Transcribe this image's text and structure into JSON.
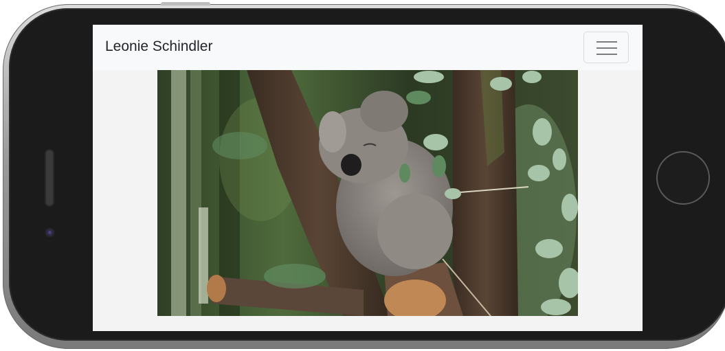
{
  "navbar": {
    "brand": "Leonie Schindler",
    "toggler_icon": "hamburger-menu-icon"
  },
  "content": {
    "image_subject": "koala-photo"
  }
}
